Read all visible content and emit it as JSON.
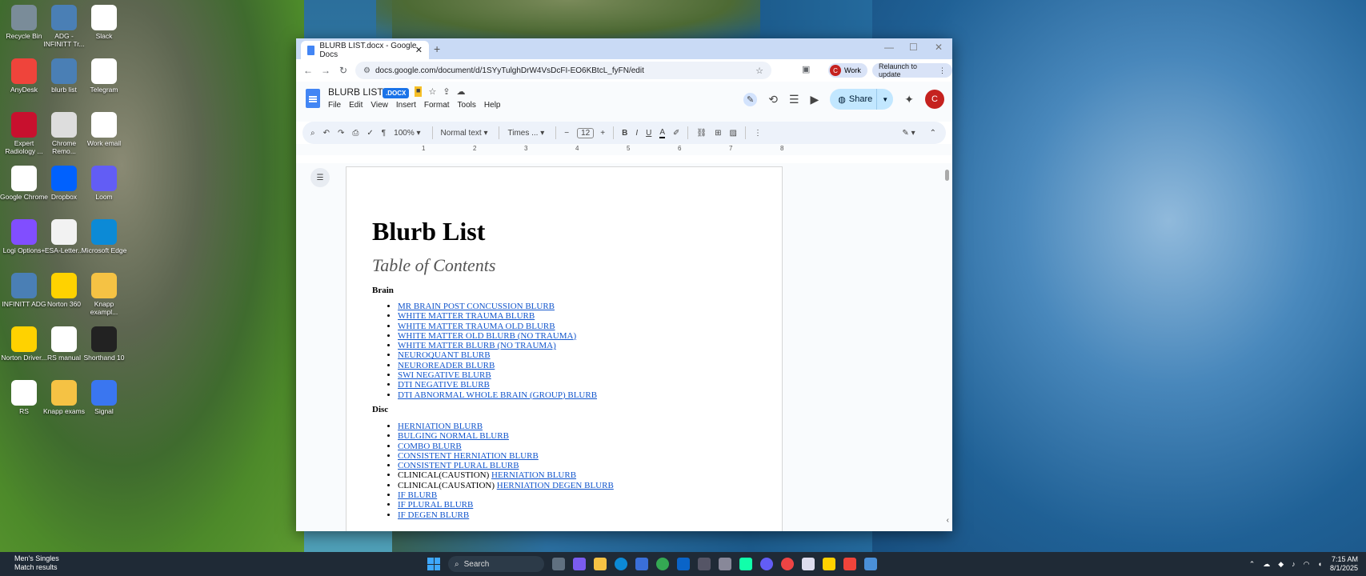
{
  "desktop_icons": [
    {
      "label": "Recycle Bin",
      "icon": "recycle-bin-icon",
      "color": "#7a8c99"
    },
    {
      "label": "ADG - INFINITT Tr...",
      "icon": "globe-icon",
      "color": "#4a7fb5"
    },
    {
      "label": "Slack",
      "icon": "slack-icon",
      "color": "#ffffff"
    },
    {
      "label": "AnyDesk",
      "icon": "anydesk-icon",
      "color": "#ef443b"
    },
    {
      "label": "blurb list",
      "icon": "globe-icon",
      "color": "#4a7fb5"
    },
    {
      "label": "Telegram",
      "icon": "telegram-icon",
      "color": "#ffffff"
    },
    {
      "label": "Expert Radiology ...",
      "icon": "pr-icon",
      "color": "#c8102e"
    },
    {
      "label": "Chrome Remo...",
      "icon": "chrome-remote-icon",
      "color": "#dddddd"
    },
    {
      "label": "Work email",
      "icon": "chrome-icon",
      "color": "#ffffff"
    },
    {
      "label": "Google Chrome",
      "icon": "chrome-icon",
      "color": "#ffffff"
    },
    {
      "label": "Dropbox",
      "icon": "dropbox-icon",
      "color": "#0061fe"
    },
    {
      "label": "Loom",
      "icon": "loom-icon",
      "color": "#625df5"
    },
    {
      "label": "Logi Options+",
      "icon": "logi-icon",
      "color": "#814eff"
    },
    {
      "label": "ESA-Letter...",
      "icon": "document-icon",
      "color": "#f2f2f2"
    },
    {
      "label": "Microsoft Edge",
      "icon": "edge-icon",
      "color": "#0c8ad6"
    },
    {
      "label": "INFINITT ADG",
      "icon": "globe-icon",
      "color": "#4a7fb5"
    },
    {
      "label": "Norton 360",
      "icon": "norton-icon",
      "color": "#ffd200"
    },
    {
      "label": "Knapp exampl...",
      "icon": "folder-icon",
      "color": "#f5c244"
    },
    {
      "label": "Norton Driver...",
      "icon": "norton-driver-icon",
      "color": "#ffd200"
    },
    {
      "label": "RS manual",
      "icon": "chrome-icon",
      "color": "#ffffff"
    },
    {
      "label": "Shorthand 10",
      "icon": "shorthand-icon",
      "color": "#222222"
    },
    {
      "label": "RS",
      "icon": "chrome-icon",
      "color": "#ffffff"
    },
    {
      "label": "Knapp exams",
      "icon": "folder-icon",
      "color": "#f5c244"
    },
    {
      "label": "Signal",
      "icon": "signal-icon",
      "color": "#3a76f0"
    }
  ],
  "browser": {
    "tab_title": "BLURB LIST.docx - Google Docs",
    "url": "docs.google.com/document/d/1SYyTulghDrW4VsDcFI-EO6KBtcL_fyFN/edit",
    "profile_label": "Work",
    "profile_initial": "C",
    "relaunch_label": "Relaunch to update"
  },
  "docs": {
    "title": "BLURB LIST",
    "badge": ".DOCX",
    "menu": [
      "File",
      "Edit",
      "View",
      "Insert",
      "Format",
      "Tools",
      "Help"
    ],
    "share_label": "Share",
    "user_initial": "C",
    "toolbar": {
      "zoom": "100%",
      "style": "Normal text",
      "font": "Times ...",
      "size": "12",
      "bold": "B",
      "italic": "I",
      "underline": "U",
      "text_color": "A"
    },
    "ruler": [
      "1",
      "2",
      "3",
      "4",
      "5",
      "6",
      "7",
      "8"
    ]
  },
  "document": {
    "heading": "Blurb List",
    "subheading": "Table of Contents",
    "sections": [
      {
        "title": "Brain",
        "items": [
          {
            "prefix": "",
            "link": "MR BRAIN POST CONCUSSION BLURB"
          },
          {
            "prefix": "",
            "link": "WHITE MATTER TRAUMA BLURB"
          },
          {
            "prefix": "",
            "link": "WHITE MATTER TRAUMA OLD BLURB"
          },
          {
            "prefix": "",
            "link": "WHITE MATTER OLD BLURB (NO TRAUMA)"
          },
          {
            "prefix": "",
            "link": "WHITE MATTER BLURB (NO TRAUMA)"
          },
          {
            "prefix": "",
            "link": "NEUROQUANT BLURB"
          },
          {
            "prefix": "",
            "link": "NEUROREADER BLURB"
          },
          {
            "prefix": "",
            "link": "SWI NEGATIVE BLURB"
          },
          {
            "prefix": "",
            "link": "DTI NEGATIVE BLURB"
          },
          {
            "prefix": "",
            "link": "DTI ABNORMAL WHOLE BRAIN (GROUP) BLURB"
          }
        ]
      },
      {
        "title": "Disc",
        "items": [
          {
            "prefix": "",
            "link": "HERNIATION BLURB"
          },
          {
            "prefix": "",
            "link": "BULGING NORMAL BLURB"
          },
          {
            "prefix": "",
            "link": "COMBO BLURB"
          },
          {
            "prefix": "",
            "link": "CONSISTENT HERNIATION BLURB"
          },
          {
            "prefix": "",
            "link": "CONSISTENT PLURAL BLURB"
          },
          {
            "prefix": "CLINICAL(CAUSTION) ",
            "link": "HERNIATION BLURB"
          },
          {
            "prefix": "CLINICAL(CAUSATION)  ",
            "link": "HERNIATION DEGEN BLURB"
          },
          {
            "prefix": "",
            "link": "IF BLURB"
          },
          {
            "prefix": "",
            "link": "IF PLURAL BLURB"
          },
          {
            "prefix": "",
            "link": "IF DEGEN BLURB"
          }
        ]
      }
    ]
  },
  "taskbar": {
    "news_title": "Men's Singles",
    "news_sub": "Match results",
    "search_label": "Search",
    "time": "7:15 AM",
    "date": "8/1/2025"
  }
}
